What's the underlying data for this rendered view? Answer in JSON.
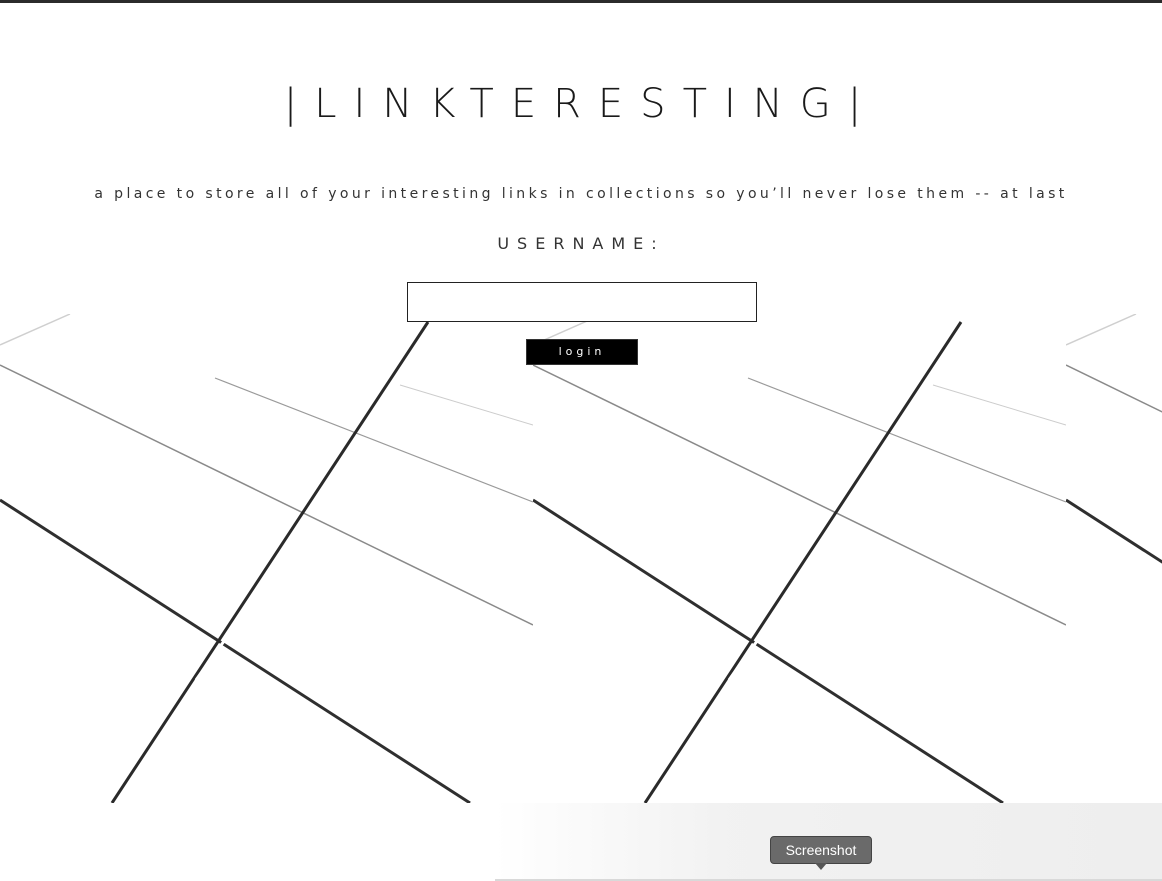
{
  "header": {
    "title": "|LINKTERESTING|",
    "tagline": "a place to store all of your interesting links in collections so you’ll never lose them -- at last"
  },
  "login_form": {
    "username_label": "USERNAME:",
    "username_value": "",
    "username_placeholder": "",
    "login_label": "login"
  },
  "tooltip": {
    "label": "Screenshot"
  },
  "colors": {
    "button_background": "#000000",
    "button_text": "#ffffff",
    "title_text": "#1a1a1a",
    "tooltip_background": "#6a6a6a"
  }
}
